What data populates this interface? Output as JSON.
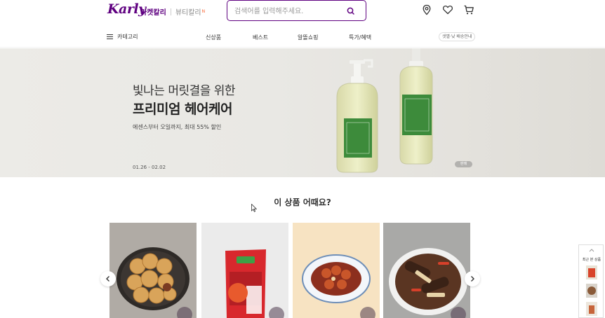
{
  "header": {
    "logo": "Karly",
    "market_tab": "마켓칼리",
    "beauty_tab": "뷰티칼리",
    "new_dot": "N",
    "search_placeholder": "검색어를 입력해주세요."
  },
  "gnb": {
    "category": "카테고리",
    "menu": [
      "신상품",
      "베스트",
      "알뜰쇼핑",
      "특가/혜택"
    ],
    "delivery": "샛별·낮 배송안내"
  },
  "banner": {
    "subtitle": "빛나는 머릿결을 위한",
    "title": "프리미엄 헤어케어",
    "description": "에센스부터 오일까지, 최대 55% 할인",
    "date": "01.26 - 02.02",
    "badge": "판매"
  },
  "recommend": {
    "title": "이 상품 어때요?",
    "prev_icon": "chevron-left-icon",
    "next_icon": "chevron-right-icon"
  },
  "recent": {
    "label": "최근 본 상품"
  },
  "colors": {
    "brand": "#5f0080",
    "accent": "#fa622f"
  }
}
